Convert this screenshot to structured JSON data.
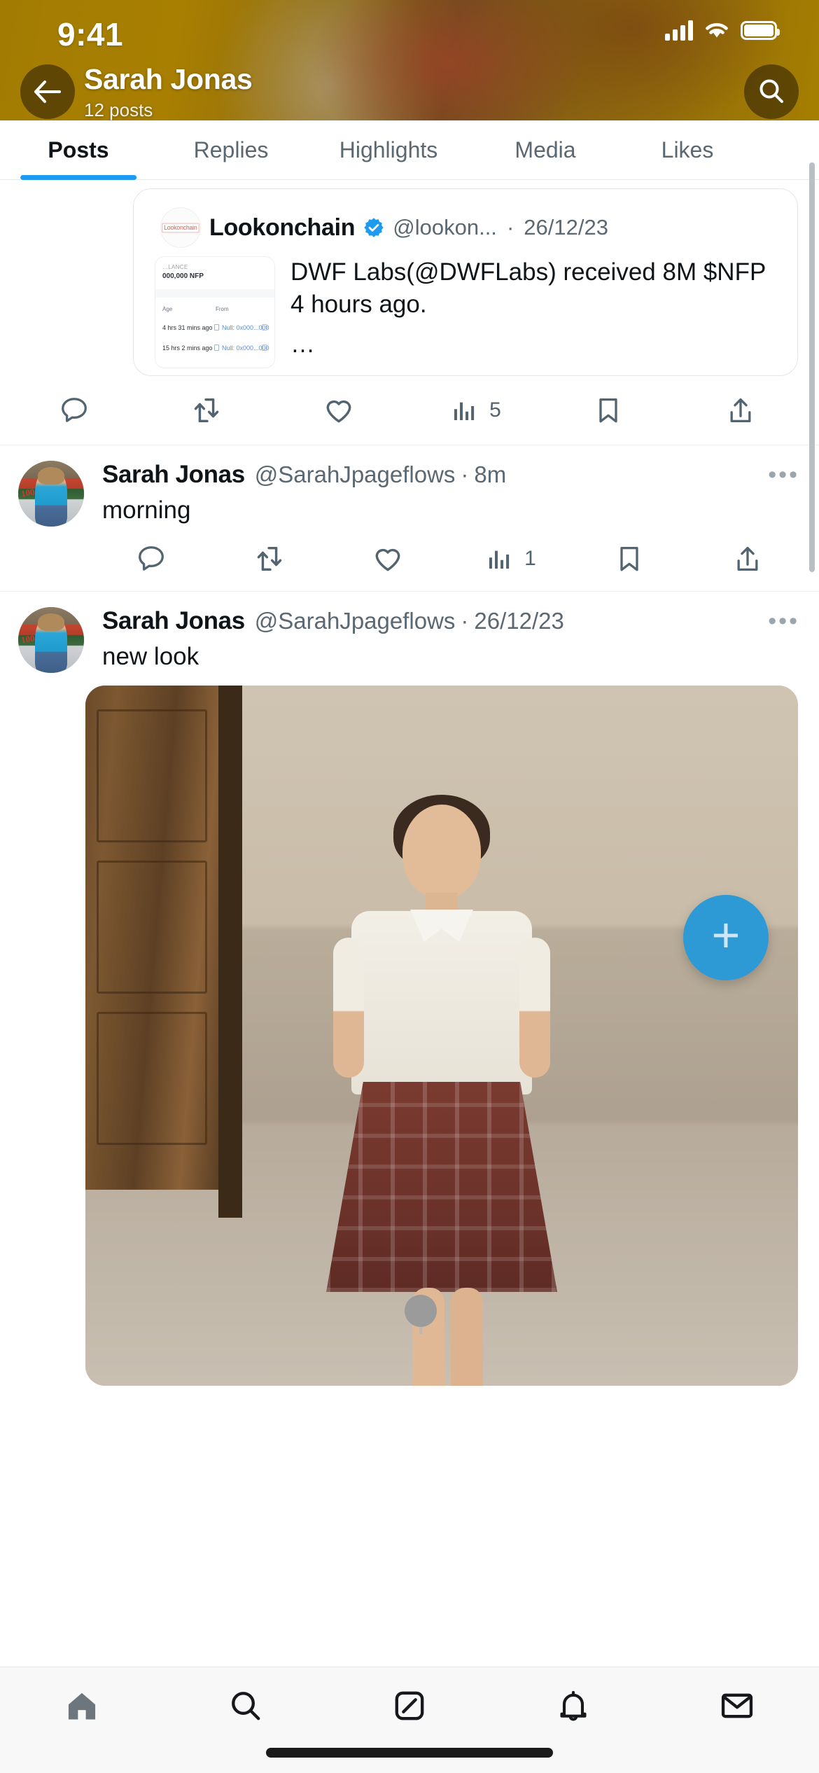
{
  "status_bar": {
    "time": "9:41",
    "signal_icon": "cellular-bars-icon",
    "wifi_icon": "wifi-icon",
    "battery_icon": "battery-icon"
  },
  "header": {
    "back_icon": "back-arrow-icon",
    "search_icon": "search-icon",
    "title": "Sarah Jonas",
    "subtitle": "12 posts"
  },
  "tabs": [
    {
      "label": "Posts",
      "active": true
    },
    {
      "label": "Replies",
      "active": false
    },
    {
      "label": "Highlights",
      "active": false
    },
    {
      "label": "Media",
      "active": false
    },
    {
      "label": "Likes",
      "active": false
    }
  ],
  "posts": [
    {
      "kind": "quoted-card",
      "author_name": "Lookonchain",
      "verified": true,
      "handle": "@lookon...",
      "separator": "·",
      "date": "26/12/23",
      "avatar_label": "Lookonchain",
      "text": "DWF Labs(@DWFLabs) received 8M $NFP 4 hours ago.",
      "more_text": "…",
      "thumbnail": {
        "balance_label": "…LANCE",
        "balance_value": "000,000 NFP",
        "col_age": "Age",
        "col_from": "From",
        "rows": [
          {
            "age": "4 hrs 31 mins ago",
            "from": "Null: 0x000...000"
          },
          {
            "age": "15 hrs 2 mins ago",
            "from": "Null: 0x000...000"
          }
        ]
      },
      "actions": {
        "reply_icon": "reply-icon",
        "reply_count": "",
        "retweet_icon": "retweet-icon",
        "retweet_count": "",
        "like_icon": "like-heart-icon",
        "like_count": "",
        "views_icon": "views-bar-chart-icon",
        "views_count": "5",
        "bookmark_icon": "bookmark-icon",
        "share_icon": "share-icon"
      }
    },
    {
      "kind": "text",
      "author_name": "Sarah Jonas",
      "handle": "@SarahJpageflows",
      "separator": "·",
      "date": "8m",
      "more_icon": "more-options-icon",
      "text": "morning",
      "actions": {
        "reply_icon": "reply-icon",
        "reply_count": "",
        "retweet_icon": "retweet-icon",
        "retweet_count": "",
        "like_icon": "like-heart-icon",
        "like_count": "",
        "views_icon": "views-bar-chart-icon",
        "views_count": "1",
        "bookmark_icon": "bookmark-icon",
        "share_icon": "share-icon"
      }
    },
    {
      "kind": "photo",
      "author_name": "Sarah Jonas",
      "handle": "@SarahJpageflows",
      "separator": "·",
      "date": "26/12/23",
      "more_icon": "more-options-icon",
      "text": "new look"
    }
  ],
  "compose": {
    "icon": "plus-icon",
    "label": "+"
  },
  "bottom_nav": [
    {
      "icon": "home-icon",
      "active": true
    },
    {
      "icon": "search-icon",
      "active": false
    },
    {
      "icon": "grok-icon",
      "active": false
    },
    {
      "icon": "notifications-bell-icon",
      "active": false
    },
    {
      "icon": "messages-envelope-icon",
      "active": false
    }
  ],
  "colors": {
    "accent": "#1d9bf0",
    "verified": "#1d9bf0",
    "fab": "#2d9ad6",
    "text": "#0f1419",
    "muted": "#536471"
  }
}
